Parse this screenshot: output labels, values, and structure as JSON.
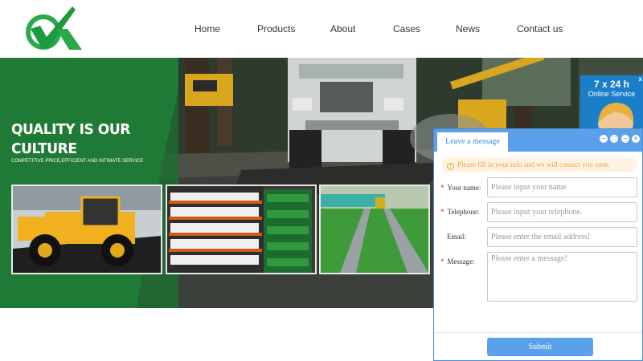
{
  "header": {
    "nav": [
      "Home",
      "Products",
      "About",
      "Cases",
      "News",
      "Contact us"
    ]
  },
  "banner": {
    "title_line1": "QUALITY IS OUR",
    "title_line2": "CULTURE",
    "subtitle": "COMPETITIVE PRICE,EFFICIENT AND INTIMATE SERVICE"
  },
  "ad": {
    "title": "7 x 24 h",
    "subtitle": "Online Service",
    "close": "x"
  },
  "widget": {
    "tab": "Leave a message",
    "notice": "Please fill in your info and we will contact you soon.",
    "fields": {
      "name_label": "Your name:",
      "name_placeholder": "Please input your name",
      "tel_label": "Telephone:",
      "tel_placeholder": "Please input your telephone.",
      "email_label": "Email:",
      "email_placeholder": "Please enter the email address!",
      "msg_label": "Message:",
      "msg_placeholder": "Please enter a message!"
    },
    "required_mark": "*",
    "submit": "Submit"
  },
  "colors": {
    "brand_green": "#1f8a3a",
    "widget_blue": "#5aa0ea",
    "notice_orange": "#f0a030"
  }
}
